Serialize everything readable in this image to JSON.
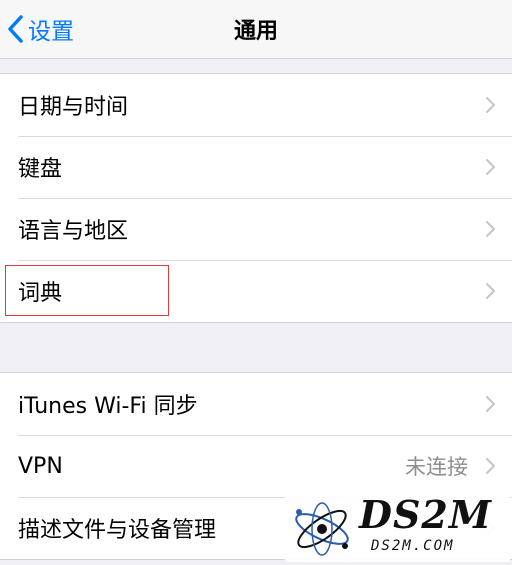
{
  "nav": {
    "back_label": "设置",
    "title": "通用"
  },
  "group1": {
    "items": [
      {
        "label": "日期与时间"
      },
      {
        "label": "键盘"
      },
      {
        "label": "语言与地区"
      },
      {
        "label": "词典"
      }
    ]
  },
  "group2": {
    "items": [
      {
        "label": "iTunes Wi-Fi 同步"
      },
      {
        "label": "VPN",
        "detail": "未连接"
      },
      {
        "label": "描述文件与设备管理"
      }
    ]
  },
  "watermark": {
    "text": "DS2M",
    "url": "DS2M.COM"
  },
  "colors": {
    "accent": "#007aff",
    "highlight": "#e03a3a",
    "background": "#efeff4"
  },
  "icons": {
    "back": "chevron-left-icon",
    "disclosure": "chevron-right-icon"
  }
}
